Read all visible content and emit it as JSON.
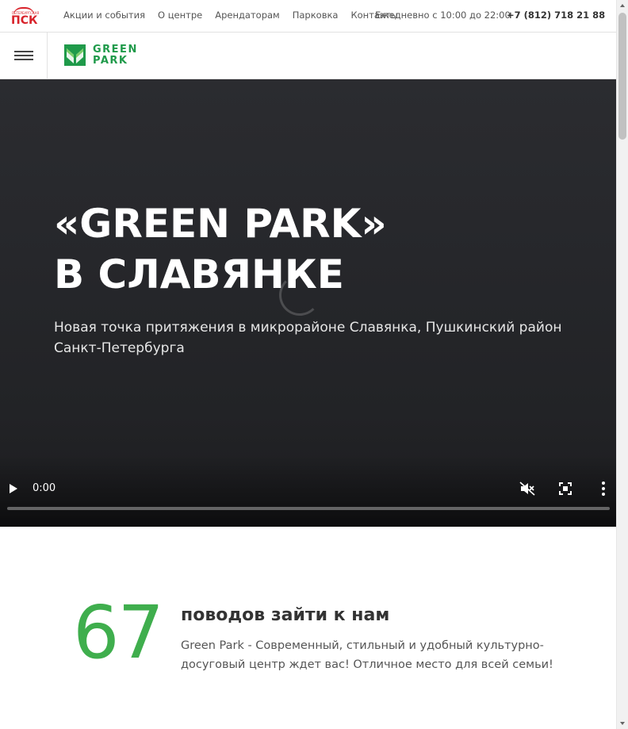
{
  "topbar": {
    "psk_logo_text": "ПСК",
    "psk_logo_small": "ПЕТЕРБУРГСКАЯ",
    "nav": [
      "Акции и события",
      "О центре",
      "Арендаторам",
      "Парковка",
      "Контакты"
    ],
    "hours": "Ежедневно с 10:00 до 22:00",
    "phone": "+7 (812) 718 21 88"
  },
  "header": {
    "logo_line1": "GREEN",
    "logo_line2": "PARK"
  },
  "hero": {
    "title_line1": "«GREEN PARK»",
    "title_line2": "В СЛАВЯНКЕ",
    "subtitle": "Новая точка притяжения в микрорайоне Славянка, Пушкинский район Санкт-Петербурга"
  },
  "video": {
    "time": "0:00",
    "progress": 0
  },
  "reasons": {
    "number": "67",
    "title": "поводов зайти к нам",
    "text": "Green Park - Современный, стильный и удобный культурно-досуговый центр ждет вас! Отличное место для всей семьи!"
  },
  "colors": {
    "brand_green": "#1f9a4a",
    "number_green": "#3fae4d",
    "psk_red": "#d8222a"
  }
}
